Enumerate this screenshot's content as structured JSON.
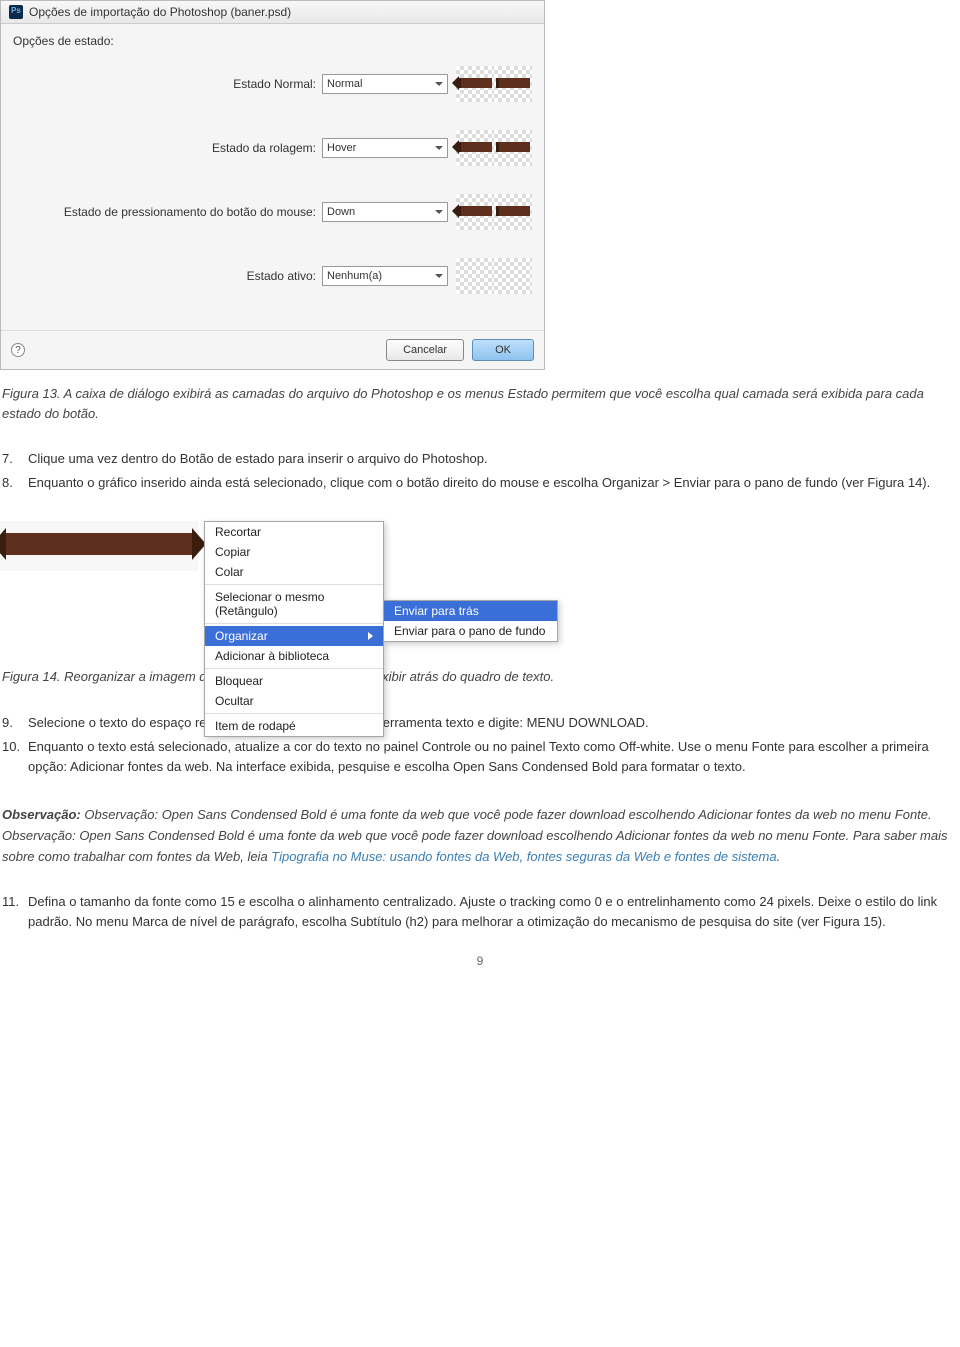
{
  "dialog": {
    "title": "Opções de importação do Photoshop (baner.psd)",
    "options_heading": "Opções de estado:",
    "states": [
      {
        "label": "Estado Normal:",
        "value": "Normal",
        "filled": true
      },
      {
        "label": "Estado da rolagem:",
        "value": "Hover",
        "filled": true
      },
      {
        "label": "Estado de pressionamento do botão do mouse:",
        "value": "Down",
        "filled": true
      },
      {
        "label": "Estado ativo:",
        "value": "Nenhum(a)",
        "filled": false
      }
    ],
    "help_glyph": "?",
    "cancel": "Cancelar",
    "ok": "OK"
  },
  "captions": {
    "fig13": "Figura 13. A caixa de diálogo exibirá as camadas do arquivo do Photoshop e os menus Estado permitem que você escolha qual camada será exibida para cada estado do botão.",
    "fig14": "Figura 14. Reorganizar a imagem de banner do Photoshop para exibir atrás do quadro de texto."
  },
  "steps_a": [
    {
      "n": "7.",
      "t": "Clique uma vez dentro do Botão de estado para inserir o arquivo do Photoshop."
    },
    {
      "n": "8.",
      "t": "Enquanto o gráfico inserido ainda está selecionado, clique com o botão direito do mouse e escolha Organizar > Enviar para o pano de fundo (ver Figura 14)."
    }
  ],
  "context_menu": {
    "items": [
      "Recortar",
      "Copiar",
      "Colar"
    ],
    "items2": [
      "Selecionar o mesmo (Retângulo)"
    ],
    "highlight": "Organizar",
    "items3": [
      "Adicionar à biblioteca"
    ],
    "items4": [
      "Bloquear",
      "Ocultar"
    ],
    "items5": [
      "Item de rodapé"
    ]
  },
  "submenu": {
    "highlight": "Enviar para trás",
    "item2": "Enviar para o pano de fundo"
  },
  "steps_b": [
    {
      "n": "9.",
      "t": "Selecione o texto do espaço reservado Lorem Ipsum com a Ferramenta texto e digite: MENU DOWNLOAD."
    },
    {
      "n": "10.",
      "t": "Enquanto o texto está selecionado, atualize a cor do texto no painel Controle ou no painel Texto como Off-white. Use o menu Fonte para escolher a primeira opção: Adicionar fontes da web. Na interface exibida, pesquise e escolha Open Sans Condensed Bold para formatar o texto."
    }
  ],
  "note": {
    "lead": "Observação:",
    "body_a": " Observação: Open Sans Condensed Bold é uma fonte da web que você pode fazer download escolhendo Adicionar fontes da web no menu Fonte. Observação: Open Sans Condensed Bold é uma fonte da web que você pode fazer download escolhendo Adicionar fontes da web no menu Fonte. Para saber mais sobre como trabalhar com fontes da Web, leia ",
    "link": "Tipografia no Muse: usando fontes da Web, fontes seguras da Web e fontes de sistema",
    "body_b": "."
  },
  "steps_c": [
    {
      "n": "11.",
      "t": "Defina o tamanho da fonte como 15 e escolha o alinhamento centralizado. Ajuste o tracking como 0 e o entrelinhamento como 24 pixels. Deixe o estilo do link padrão. No menu Marca de nível de parágrafo, escolha Subtítulo (h2) para melhorar a otimização do mecanismo de pesquisa do site (ver Figura 15)."
    }
  ],
  "page_number": "9"
}
